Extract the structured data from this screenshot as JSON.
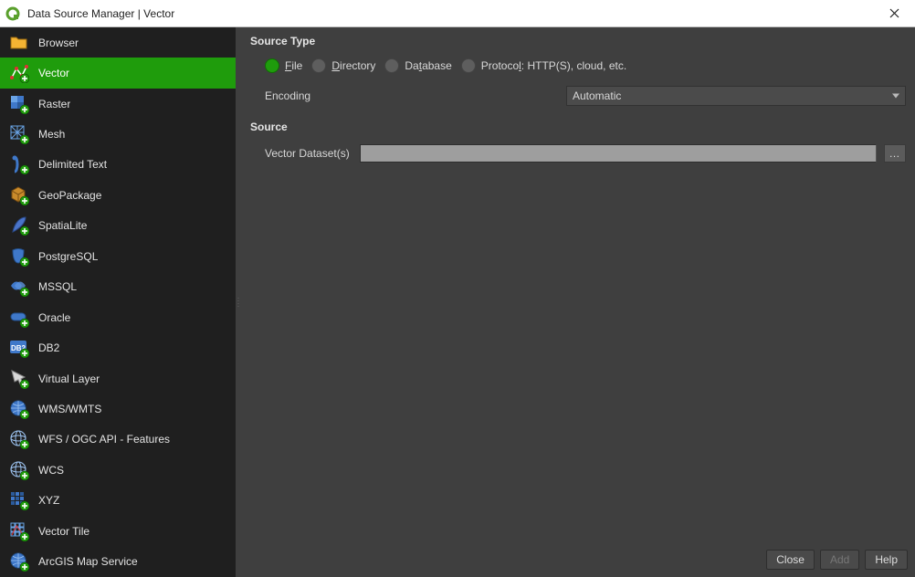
{
  "window": {
    "title": "Data Source Manager | Vector"
  },
  "sidebar": {
    "items": [
      {
        "name": "browser",
        "label": "Browser",
        "selected": false,
        "icon": "folder"
      },
      {
        "name": "vector",
        "label": "Vector",
        "selected": true,
        "icon": "vector"
      },
      {
        "name": "raster",
        "label": "Raster",
        "selected": false,
        "icon": "raster"
      },
      {
        "name": "mesh",
        "label": "Mesh",
        "selected": false,
        "icon": "mesh"
      },
      {
        "name": "delimited",
        "label": "Delimited Text",
        "selected": false,
        "icon": "delim"
      },
      {
        "name": "geopackage",
        "label": "GeoPackage",
        "selected": false,
        "icon": "geopkg"
      },
      {
        "name": "spatialite",
        "label": "SpatiaLite",
        "selected": false,
        "icon": "feather"
      },
      {
        "name": "postgresql",
        "label": "PostgreSQL",
        "selected": false,
        "icon": "postgres"
      },
      {
        "name": "mssql",
        "label": "MSSQL",
        "selected": false,
        "icon": "mssql"
      },
      {
        "name": "oracle",
        "label": "Oracle",
        "selected": false,
        "icon": "oracle"
      },
      {
        "name": "db2",
        "label": "DB2",
        "selected": false,
        "icon": "db2"
      },
      {
        "name": "virtual",
        "label": "Virtual Layer",
        "selected": false,
        "icon": "virtual"
      },
      {
        "name": "wmswmts",
        "label": "WMS/WMTS",
        "selected": false,
        "icon": "globe"
      },
      {
        "name": "wfs",
        "label": "WFS / OGC API - Features",
        "selected": false,
        "icon": "globegrid"
      },
      {
        "name": "wcs",
        "label": "WCS",
        "selected": false,
        "icon": "globegrid"
      },
      {
        "name": "xyz",
        "label": "XYZ",
        "selected": false,
        "icon": "xyz"
      },
      {
        "name": "vectortile",
        "label": "Vector Tile",
        "selected": false,
        "icon": "vectortile"
      },
      {
        "name": "arcgis",
        "label": "ArcGIS Map Service",
        "selected": false,
        "icon": "globe"
      }
    ]
  },
  "main": {
    "source_type_section": "Source Type",
    "radios": {
      "file": {
        "underline": "F",
        "rest": "ile",
        "checked": true
      },
      "directory": {
        "underline": "D",
        "rest": "irectory",
        "checked": false
      },
      "database": {
        "prefix": "Da",
        "underline": "t",
        "rest": "abase",
        "checked": false
      },
      "protocol": {
        "prefix": "Protoco",
        "underline": "l",
        "rest": ": HTTP(S), cloud, etc.",
        "checked": false
      }
    },
    "encoding_label": "Encoding",
    "encoding_value": "Automatic",
    "source_section": "Source",
    "vector_datasets_label": "Vector Dataset(s)",
    "vector_datasets_value": "",
    "browse_label": "…"
  },
  "footer": {
    "close": "Close",
    "add": "Add",
    "help": "Help",
    "add_enabled": false
  }
}
